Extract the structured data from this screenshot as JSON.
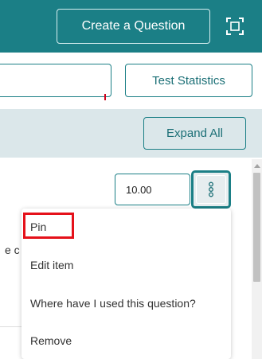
{
  "header": {
    "create_question_label": "Create a Question",
    "expand_icon": "fullscreen-expand-icon"
  },
  "toolbar": {
    "search_value": "",
    "test_statistics_label": "Test Statistics"
  },
  "section": {
    "expand_all_label": "Expand All"
  },
  "question": {
    "points_value": "10.00",
    "partial_text": "e c",
    "more_icon": "kebab-more-icon"
  },
  "menu": {
    "items": [
      {
        "label": "Pin",
        "highlighted": true
      },
      {
        "label": "Edit item"
      },
      {
        "label": "Where have I used this question?"
      },
      {
        "label": "Remove"
      }
    ]
  },
  "colors": {
    "header_bg": "#1b7f86",
    "accent": "#1b7f86",
    "section_band": "#dbe7ea",
    "highlight": "#e5111a"
  }
}
